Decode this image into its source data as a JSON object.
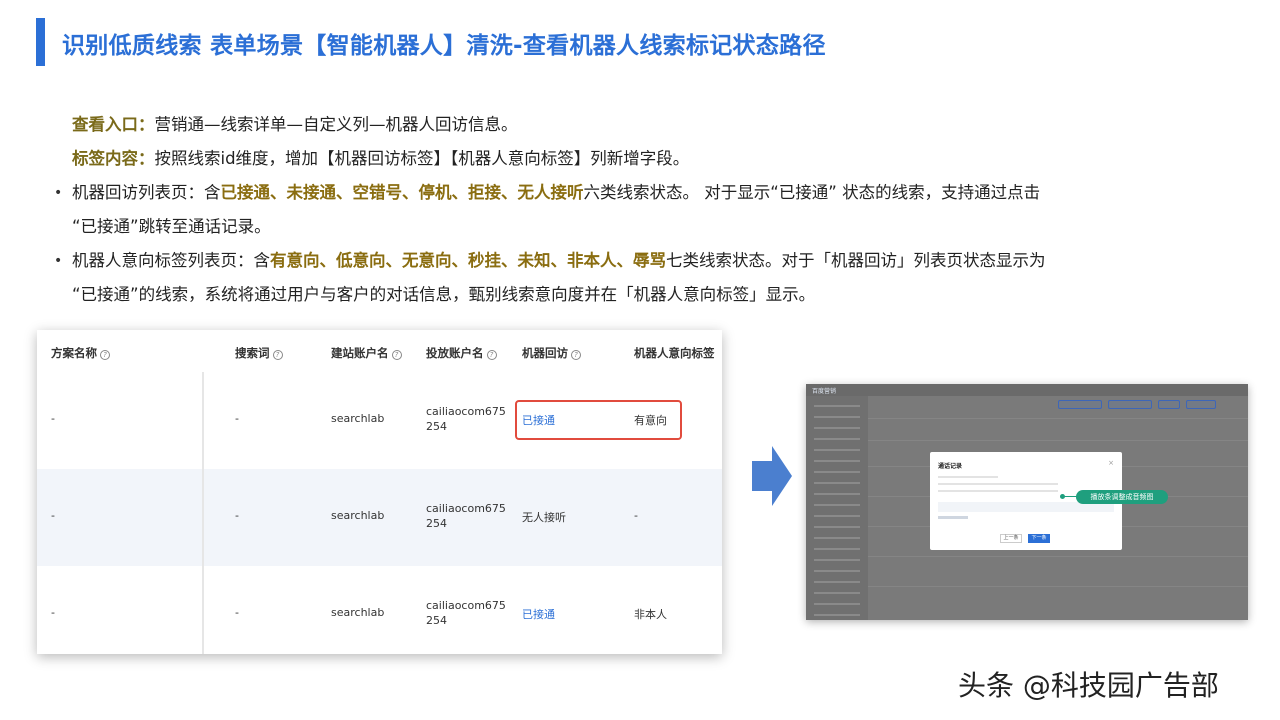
{
  "title": "识别低质线索 表单场景【智能机器人】清洗-查看机器人线索标记状态路径",
  "entry": {
    "label": "查看入口：",
    "text": "营销通—线索详单—自定义列—机器人回访信息。"
  },
  "tag_content": {
    "label": "标签内容：",
    "text": "按照线索id维度，增加【机器回访标签】【机器人意向标签】列新增字段。"
  },
  "bullet1": {
    "prefix": "机器回访列表页：含",
    "highlight": "已接通、未接通、空错号、停机、拒接、无人接听",
    "suffix": "六类线索状态。 对于显示“已接通” 状态的线索，支持通过点击",
    "line2": "“已接通”跳转至通话记录。"
  },
  "bullet2": {
    "prefix": "机器人意向标签列表页：含",
    "highlight": "有意向、低意向、无意向、秒挂、未知、非本人、辱骂",
    "suffix": "七类线索状态。对于「机器回访」列表页状态显示为",
    "line2": "“已接通”的线索，系统将通过用户与客户的对话信息，甄别线索意向度并在「机器人意向标签」显示。"
  },
  "table": {
    "headers": [
      "方案名称",
      "搜索词",
      "建站账户名",
      "投放账户名",
      "机器回访",
      "机器人意向标签"
    ],
    "help_glyph": "?",
    "rows": [
      {
        "plan": "-",
        "keyword": "-",
        "site_account": "searchlab",
        "ad_account_1": "cailiaocom675",
        "ad_account_2": "254",
        "robot_call": "已接通",
        "robot_intent": "有意向"
      },
      {
        "plan": "-",
        "keyword": "-",
        "site_account": "searchlab",
        "ad_account_1": "cailiaocom675",
        "ad_account_2": "254",
        "robot_call": "无人接听",
        "robot_intent": "-"
      },
      {
        "plan": "-",
        "keyword": "-",
        "site_account": "searchlab",
        "ad_account_1": "cailiaocom675",
        "ad_account_2": "254",
        "robot_call": "已接通",
        "robot_intent": "非本人"
      }
    ]
  },
  "screenshot": {
    "brand": "百度营销",
    "modal_title": "通话记录",
    "close": "×",
    "prev": "上一条",
    "next": "下一条",
    "tip": "播放条调整成音频图"
  },
  "watermark": "头条 @科技园广告部",
  "colors": {
    "accent": "#2b6fd6",
    "highlight": "#8a6d10",
    "alert_border": "#e14b3d",
    "tip": "#1f9f7e"
  }
}
